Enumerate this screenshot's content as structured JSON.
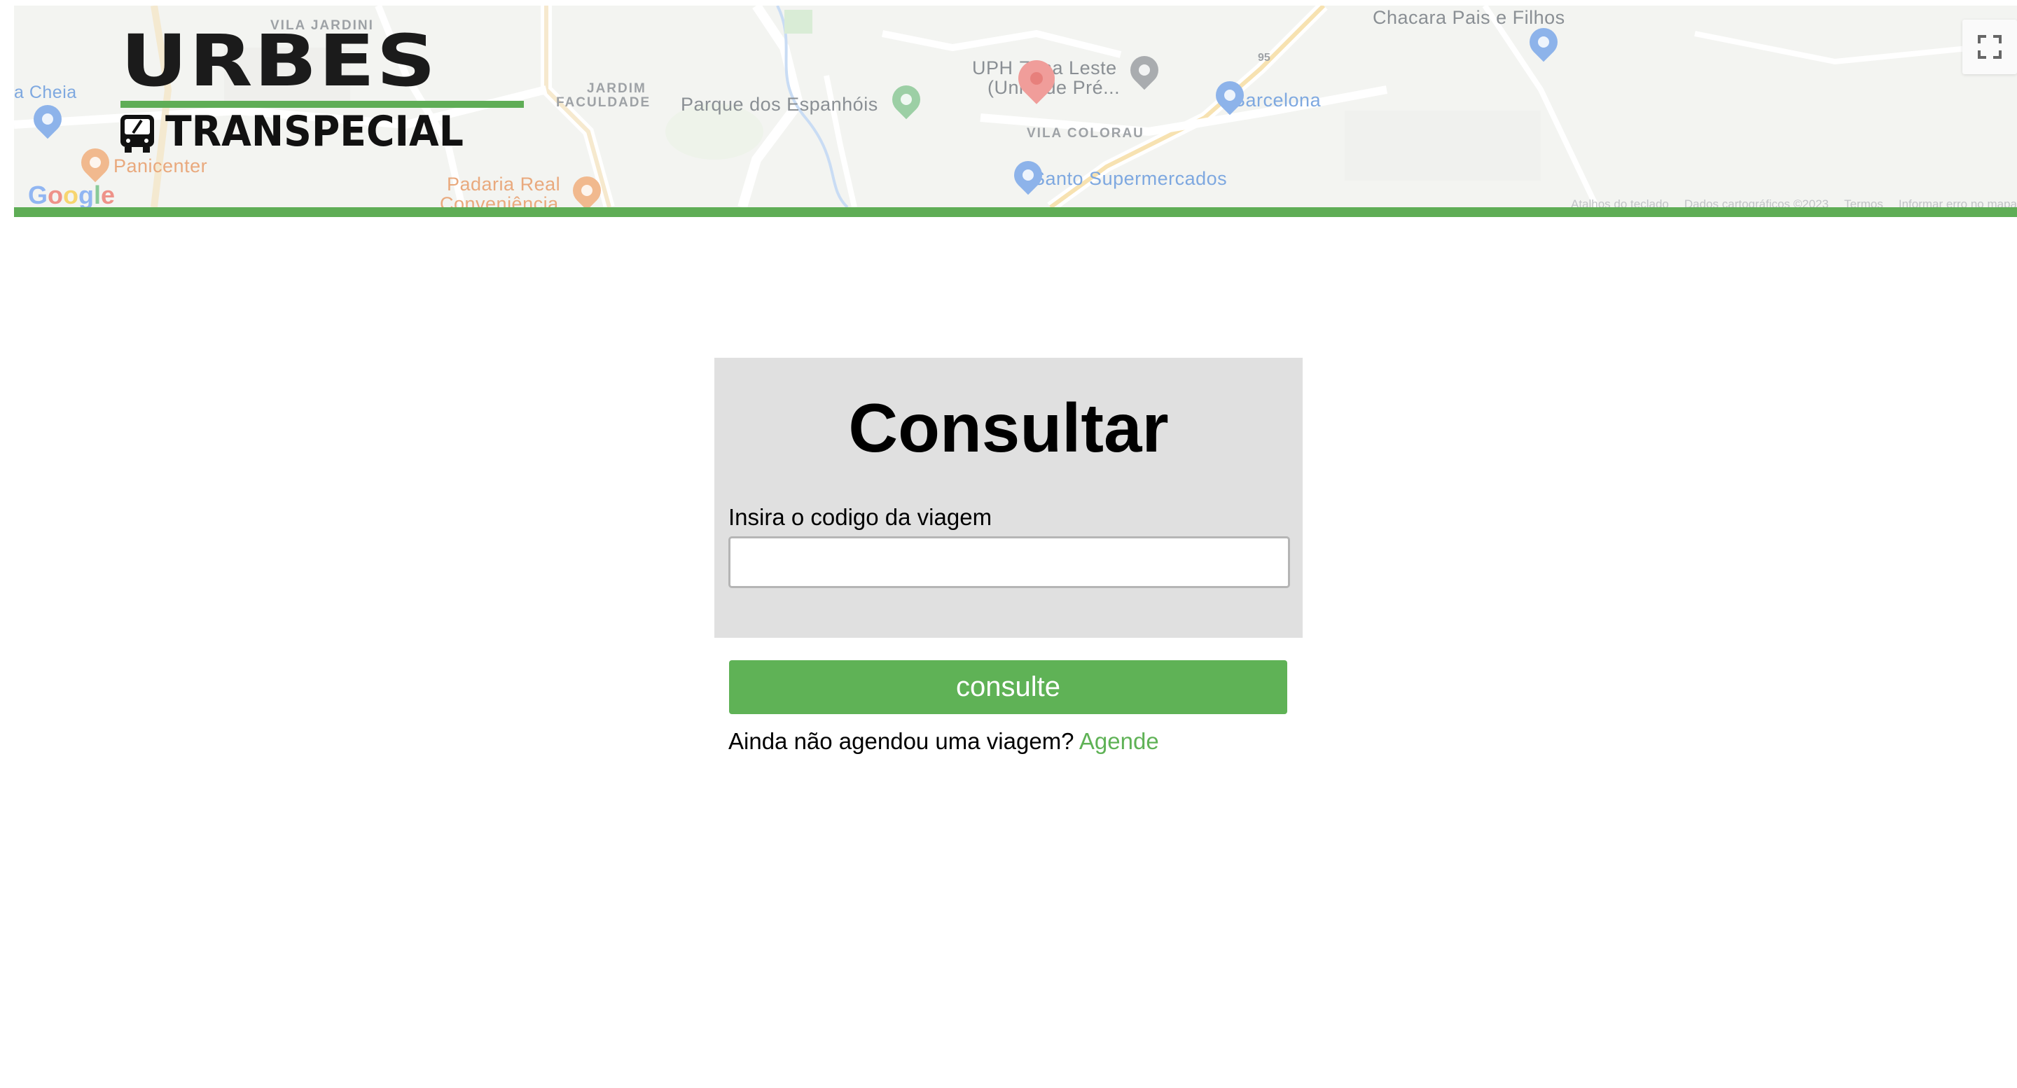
{
  "header": {
    "logo": {
      "main_text": "URBES",
      "sub_text": "TRANSPECIAL"
    },
    "map": {
      "labels": {
        "vila_jardini": "VILA JARDINI",
        "a_cheia": "a Cheia",
        "jardim_faculdade_1": "JARDIM",
        "jardim_faculdade_2": "FACULDADE",
        "parque_espanhois": "Parque dos Espanhóis",
        "uph_1": "UPH Zona Leste",
        "uph_2": "(Unidade Pré...",
        "chacara": "Chacara Pais e Filhos",
        "barcelona": "Barcelona",
        "vila_colorau": "VILA COLORAU",
        "santo_supermercados": "Santo Supermercados",
        "panicenter": "Panicenter",
        "padaria_1": "Padaria Real",
        "padaria_2": "Conveniência",
        "road_95": "95"
      },
      "google_letters": [
        "G",
        "o",
        "o",
        "g",
        "l",
        "e"
      ],
      "footer": {
        "shortcuts": "Atalhos do teclado",
        "map_data": "Dados cartográficos ©2023",
        "terms": "Termos",
        "report": "Informar erro no mapa"
      },
      "icons": {
        "fullscreen": "fullscreen-icon",
        "marker": "map-marker-icon"
      }
    }
  },
  "form": {
    "title": "Consultar",
    "field_label": "Insira o codigo da viagem",
    "input_value": "",
    "input_placeholder": "",
    "submit_label": "consulte"
  },
  "footer_prompt": {
    "text": "Ainda não agendou uma viagem?",
    "link_label": "Agende"
  },
  "colors": {
    "accent_green": "#5fb256",
    "card_background": "#e0e0e0",
    "header_bar": "#5fad56"
  }
}
